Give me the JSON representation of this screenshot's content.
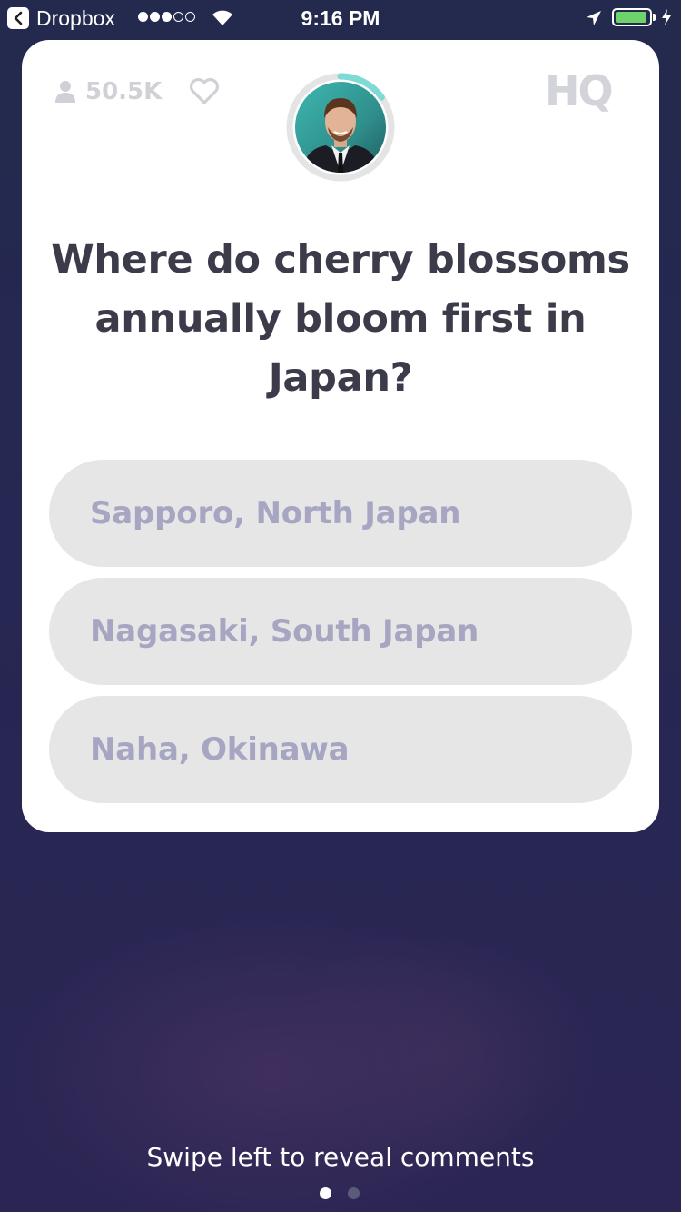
{
  "status_bar": {
    "back_app": "Dropbox",
    "time": "9:16 PM",
    "signal_bars": 3,
    "signal_total": 5,
    "battery_level": 0.95,
    "battery_color": "#6fd36b"
  },
  "header": {
    "viewer_count": "50.5K",
    "logo": "HQ",
    "timer_progress": 0.15,
    "timer_color": "#7fd9d4"
  },
  "question": "Where do cherry blossoms annually bloom first in Japan?",
  "answers": [
    "Sapporo, North Japan",
    "Nagasaki, South Japan",
    "Naha, Okinawa"
  ],
  "footer": {
    "hint": "Swipe left to reveal comments",
    "pages": 2,
    "current_page": 1
  },
  "colors": {
    "card": "#ffffff",
    "answer_bg": "#e6e6e6",
    "answer_text": "#a7a6c2",
    "question_text": "#3c3b4a",
    "background": "#262752"
  }
}
